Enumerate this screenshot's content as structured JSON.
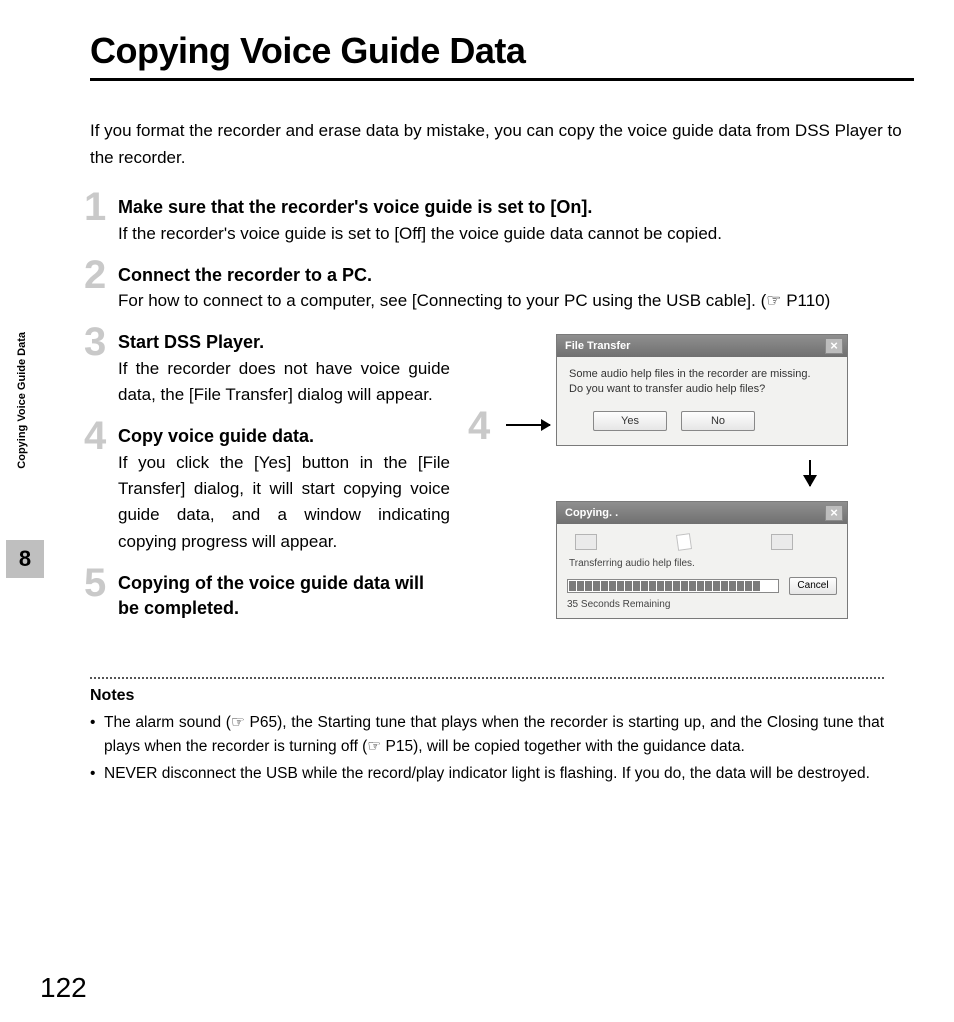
{
  "title": "Copying Voice Guide Data",
  "intro": "If you format the recorder and erase data by mistake, you can copy the voice guide data from DSS Player to the recorder.",
  "steps": [
    {
      "num": "1",
      "title": "Make sure that the recorder's voice guide is set to [On].",
      "body": "If the recorder's voice guide is set to [Off] the voice guide data cannot be copied."
    },
    {
      "num": "2",
      "title": "Connect the recorder to a PC.",
      "body": "For how to connect to a computer, see [Connecting to your PC using the USB cable]. (☞ P110)"
    },
    {
      "num": "3",
      "title": "Start DSS Player.",
      "body": "If the recorder does not have voice guide data, the [File Transfer] dialog will appear."
    },
    {
      "num": "4",
      "title": "Copy voice guide data.",
      "body": "If you click the [Yes] button in the [File Transfer] dialog, it will start copying voice guide data, and a window indicating copying progress will appear."
    },
    {
      "num": "5",
      "title": "Copying of the voice guide data will be completed.",
      "body": ""
    }
  ],
  "figure_marker": "4",
  "dialog1": {
    "title": "File Transfer",
    "msg1": "Some audio help files in the recorder are missing.",
    "msg2": "Do you want to transfer audio help files?",
    "yes": "Yes",
    "no": "No"
  },
  "dialog2": {
    "title": "Copying. .",
    "status": "Transferring audio help files.",
    "cancel": "Cancel",
    "remaining": "35 Seconds Remaining"
  },
  "notes_title": "Notes",
  "notes": [
    "The alarm sound (☞ P65), the Starting tune that plays when the recorder is starting up, and the Closing tune that plays when the recorder is turning off (☞ P15), will be copied together with the guidance data.",
    "NEVER disconnect the USB while the record/play indicator light is flashing. If you do, the data will be destroyed."
  ],
  "side_label": "Copying Voice Guide Data",
  "chapter": "8",
  "page_num": "122"
}
